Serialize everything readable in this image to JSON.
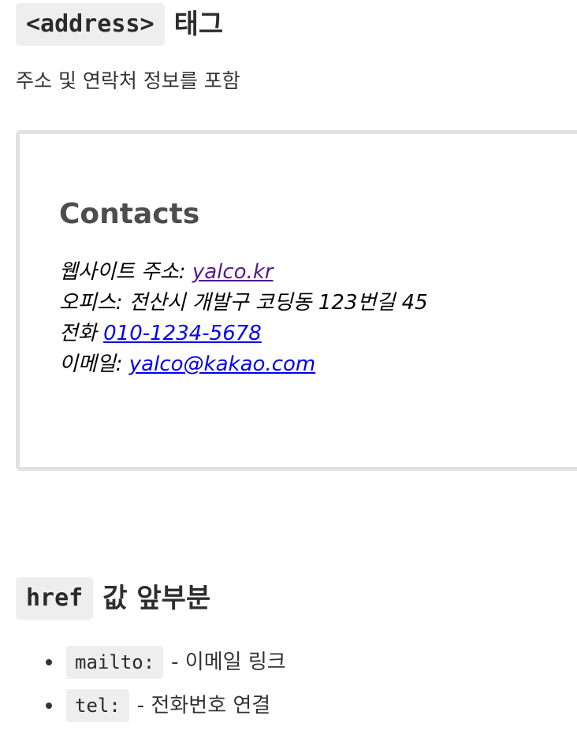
{
  "section1": {
    "tag_code": "<address>",
    "title_suffix": "태그",
    "intro": "주소 및 연락처 정보를 포함"
  },
  "demo": {
    "contacts_heading": "Contacts",
    "website_label": "웹사이트 주소: ",
    "website_link": "yalco.kr",
    "office_text": "오피스: 전산시 개발구 코딩동 123번길 45",
    "phone_label": "전화 ",
    "phone_link": "010-1234-5678",
    "email_label": "이메일: ",
    "email_link": "yalco@kakao.com"
  },
  "section2": {
    "code": "href",
    "title_suffix": "값 앞부분",
    "items": [
      {
        "code": "mailto:",
        "desc": "- 이메일 링크"
      },
      {
        "code": "tel:",
        "desc": "- 전화번호 연결"
      }
    ]
  }
}
